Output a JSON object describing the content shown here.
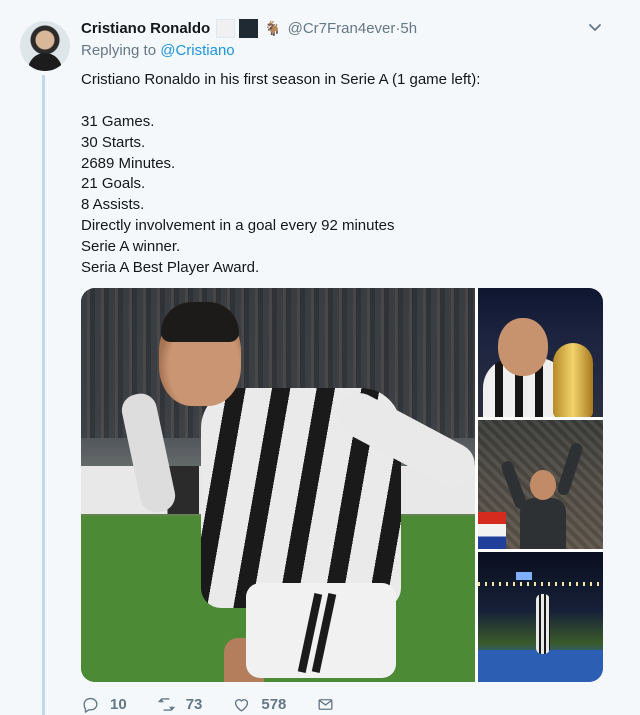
{
  "tweet": {
    "author_name": "Cristiano Ronaldo",
    "handle": "@Cr7Fran4ever",
    "separator": " · ",
    "time": "5h",
    "replying_prefix": "Replying to ",
    "replying_to": "@Cristiano",
    "lines": [
      "Cristiano Ronaldo in his first season in Serie A (1 game left):",
      "",
      "31 Games.",
      "30 Starts.",
      "2689 Minutes.",
      "21 Goals.",
      "8 Assists.",
      "Directly involvement in a goal every 92 minutes",
      "Serie A winner.",
      "Seria A Best Player Award."
    ],
    "icons": {
      "name_emoji_1": "white-square-emoji",
      "name_emoji_2": "black-square-emoji",
      "name_emoji_3": "goat-emoji",
      "more": "chevron-down-icon"
    }
  },
  "actions": {
    "replies": "10",
    "retweets": "73",
    "likes": "578",
    "icons": [
      "reply-icon",
      "retweet-icon",
      "like-icon",
      "message-icon"
    ]
  },
  "colors": {
    "background": "#f5f8fa",
    "link": "#1b95e0",
    "muted": "#657786",
    "thread_line": "#c3d9eb"
  }
}
